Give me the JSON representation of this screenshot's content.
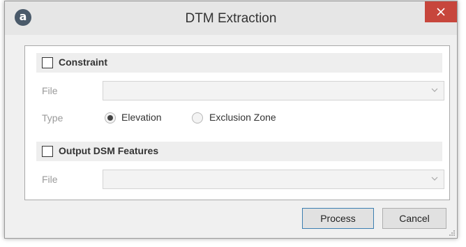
{
  "window": {
    "title": "DTM Extraction",
    "app_icon_glyph": "a",
    "close_icon": "close-icon"
  },
  "constraint": {
    "label": "Constraint",
    "checked": false,
    "file_label": "File",
    "file_value": "",
    "type_label": "Type",
    "type_options": [
      {
        "label": "Elevation",
        "selected": true
      },
      {
        "label": "Exclusion Zone",
        "selected": false
      }
    ]
  },
  "output_dsm": {
    "label": "Output DSM Features",
    "checked": false,
    "file_label": "File",
    "file_value": ""
  },
  "buttons": {
    "process": "Process",
    "cancel": "Cancel"
  },
  "colors": {
    "close_button": "#c7463c",
    "window_bg": "#f0f0f0",
    "default_button_border": "#3c7fb1"
  }
}
